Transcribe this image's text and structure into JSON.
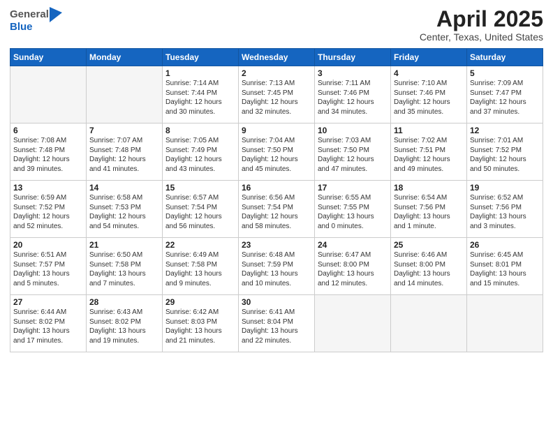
{
  "header": {
    "logo_general": "General",
    "logo_blue": "Blue",
    "title": "April 2025",
    "location": "Center, Texas, United States"
  },
  "days_of_week": [
    "Sunday",
    "Monday",
    "Tuesday",
    "Wednesday",
    "Thursday",
    "Friday",
    "Saturday"
  ],
  "weeks": [
    [
      {
        "day": "",
        "info": ""
      },
      {
        "day": "",
        "info": ""
      },
      {
        "day": "1",
        "info": "Sunrise: 7:14 AM\nSunset: 7:44 PM\nDaylight: 12 hours and 30 minutes."
      },
      {
        "day": "2",
        "info": "Sunrise: 7:13 AM\nSunset: 7:45 PM\nDaylight: 12 hours and 32 minutes."
      },
      {
        "day": "3",
        "info": "Sunrise: 7:11 AM\nSunset: 7:46 PM\nDaylight: 12 hours and 34 minutes."
      },
      {
        "day": "4",
        "info": "Sunrise: 7:10 AM\nSunset: 7:46 PM\nDaylight: 12 hours and 35 minutes."
      },
      {
        "day": "5",
        "info": "Sunrise: 7:09 AM\nSunset: 7:47 PM\nDaylight: 12 hours and 37 minutes."
      }
    ],
    [
      {
        "day": "6",
        "info": "Sunrise: 7:08 AM\nSunset: 7:48 PM\nDaylight: 12 hours and 39 minutes."
      },
      {
        "day": "7",
        "info": "Sunrise: 7:07 AM\nSunset: 7:48 PM\nDaylight: 12 hours and 41 minutes."
      },
      {
        "day": "8",
        "info": "Sunrise: 7:05 AM\nSunset: 7:49 PM\nDaylight: 12 hours and 43 minutes."
      },
      {
        "day": "9",
        "info": "Sunrise: 7:04 AM\nSunset: 7:50 PM\nDaylight: 12 hours and 45 minutes."
      },
      {
        "day": "10",
        "info": "Sunrise: 7:03 AM\nSunset: 7:50 PM\nDaylight: 12 hours and 47 minutes."
      },
      {
        "day": "11",
        "info": "Sunrise: 7:02 AM\nSunset: 7:51 PM\nDaylight: 12 hours and 49 minutes."
      },
      {
        "day": "12",
        "info": "Sunrise: 7:01 AM\nSunset: 7:52 PM\nDaylight: 12 hours and 50 minutes."
      }
    ],
    [
      {
        "day": "13",
        "info": "Sunrise: 6:59 AM\nSunset: 7:52 PM\nDaylight: 12 hours and 52 minutes."
      },
      {
        "day": "14",
        "info": "Sunrise: 6:58 AM\nSunset: 7:53 PM\nDaylight: 12 hours and 54 minutes."
      },
      {
        "day": "15",
        "info": "Sunrise: 6:57 AM\nSunset: 7:54 PM\nDaylight: 12 hours and 56 minutes."
      },
      {
        "day": "16",
        "info": "Sunrise: 6:56 AM\nSunset: 7:54 PM\nDaylight: 12 hours and 58 minutes."
      },
      {
        "day": "17",
        "info": "Sunrise: 6:55 AM\nSunset: 7:55 PM\nDaylight: 13 hours and 0 minutes."
      },
      {
        "day": "18",
        "info": "Sunrise: 6:54 AM\nSunset: 7:56 PM\nDaylight: 13 hours and 1 minute."
      },
      {
        "day": "19",
        "info": "Sunrise: 6:52 AM\nSunset: 7:56 PM\nDaylight: 13 hours and 3 minutes."
      }
    ],
    [
      {
        "day": "20",
        "info": "Sunrise: 6:51 AM\nSunset: 7:57 PM\nDaylight: 13 hours and 5 minutes."
      },
      {
        "day": "21",
        "info": "Sunrise: 6:50 AM\nSunset: 7:58 PM\nDaylight: 13 hours and 7 minutes."
      },
      {
        "day": "22",
        "info": "Sunrise: 6:49 AM\nSunset: 7:58 PM\nDaylight: 13 hours and 9 minutes."
      },
      {
        "day": "23",
        "info": "Sunrise: 6:48 AM\nSunset: 7:59 PM\nDaylight: 13 hours and 10 minutes."
      },
      {
        "day": "24",
        "info": "Sunrise: 6:47 AM\nSunset: 8:00 PM\nDaylight: 13 hours and 12 minutes."
      },
      {
        "day": "25",
        "info": "Sunrise: 6:46 AM\nSunset: 8:00 PM\nDaylight: 13 hours and 14 minutes."
      },
      {
        "day": "26",
        "info": "Sunrise: 6:45 AM\nSunset: 8:01 PM\nDaylight: 13 hours and 15 minutes."
      }
    ],
    [
      {
        "day": "27",
        "info": "Sunrise: 6:44 AM\nSunset: 8:02 PM\nDaylight: 13 hours and 17 minutes."
      },
      {
        "day": "28",
        "info": "Sunrise: 6:43 AM\nSunset: 8:02 PM\nDaylight: 13 hours and 19 minutes."
      },
      {
        "day": "29",
        "info": "Sunrise: 6:42 AM\nSunset: 8:03 PM\nDaylight: 13 hours and 21 minutes."
      },
      {
        "day": "30",
        "info": "Sunrise: 6:41 AM\nSunset: 8:04 PM\nDaylight: 13 hours and 22 minutes."
      },
      {
        "day": "",
        "info": ""
      },
      {
        "day": "",
        "info": ""
      },
      {
        "day": "",
        "info": ""
      }
    ]
  ]
}
